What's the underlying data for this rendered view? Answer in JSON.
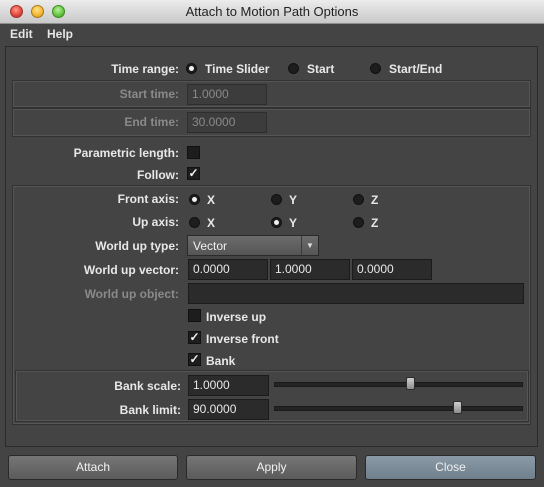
{
  "window": {
    "title": "Attach to Motion Path Options"
  },
  "menu": {
    "edit": "Edit",
    "help": "Help"
  },
  "time_range": {
    "label": "Time range:",
    "options": [
      "Time Slider",
      "Start",
      "Start/End"
    ],
    "selected": "Time Slider"
  },
  "start_time": {
    "label": "Start time:",
    "value": "1.0000"
  },
  "end_time": {
    "label": "End time:",
    "value": "30.0000"
  },
  "parametric_length": {
    "label": "Parametric length:",
    "checked": false
  },
  "follow": {
    "label": "Follow:",
    "checked": true
  },
  "front_axis": {
    "label": "Front axis:",
    "options": [
      "X",
      "Y",
      "Z"
    ],
    "selected": "X"
  },
  "up_axis": {
    "label": "Up axis:",
    "options": [
      "X",
      "Y",
      "Z"
    ],
    "selected": "Y"
  },
  "world_up_type": {
    "label": "World up type:",
    "value": "Vector"
  },
  "world_up_vector": {
    "label": "World up vector:",
    "values": [
      "0.0000",
      "1.0000",
      "0.0000"
    ]
  },
  "world_up_object": {
    "label": "World up object:",
    "value": ""
  },
  "inverse_up": {
    "label": "Inverse up",
    "checked": false
  },
  "inverse_front": {
    "label": "Inverse front",
    "checked": true
  },
  "bank": {
    "label": "Bank",
    "checked": true
  },
  "bank_scale": {
    "label": "Bank scale:",
    "value": "1.0000",
    "slider_fraction": 0.55
  },
  "bank_limit": {
    "label": "Bank limit:",
    "value": "90.0000",
    "slider_fraction": 0.74
  },
  "buttons": {
    "attach": "Attach",
    "apply": "Apply",
    "close": "Close"
  }
}
